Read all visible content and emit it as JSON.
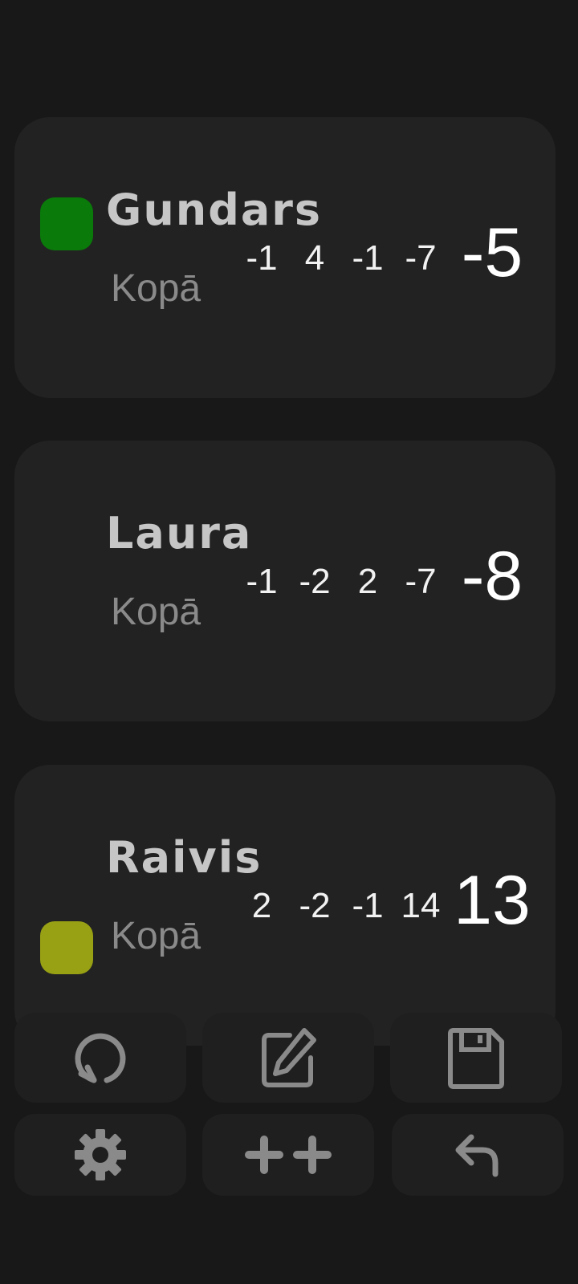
{
  "players": [
    {
      "name": "Gundars",
      "total_label": "Kopā",
      "scores": [
        "-1",
        "4",
        "-1",
        "-7"
      ],
      "total": "-5",
      "marker_color": "#0a7a0a"
    },
    {
      "name": "Laura",
      "total_label": "Kopā",
      "scores": [
        "-1",
        "-2",
        "2",
        "-7"
      ],
      "total": "-8",
      "marker_color": null
    },
    {
      "name": "Raivis",
      "total_label": "Kopā",
      "scores": [
        "2",
        "-2",
        "-1",
        "14"
      ],
      "total": "13",
      "marker_color": "#98a014"
    }
  ],
  "toolbar": {
    "buttons": [
      {
        "icon": "reset-icon"
      },
      {
        "icon": "edit-icon"
      },
      {
        "icon": "save-icon"
      },
      {
        "icon": "gear-icon"
      },
      {
        "icon": "plus-plus-icon"
      },
      {
        "icon": "undo-icon"
      }
    ],
    "icon_color": "#8a8a8a"
  },
  "colors": {
    "background": "#181818",
    "card": "#222222",
    "button": "#1f1f1f"
  }
}
